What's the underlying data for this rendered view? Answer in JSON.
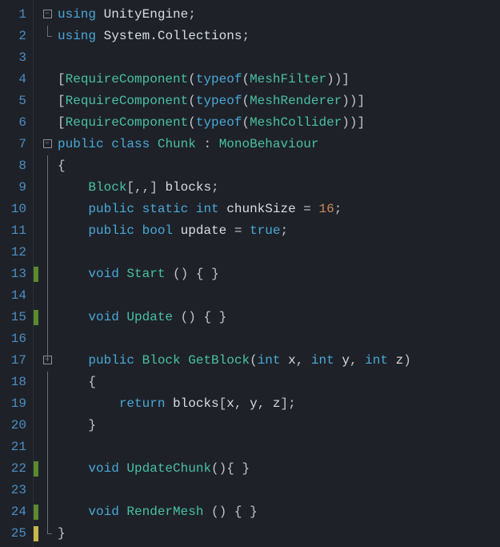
{
  "lines": [
    "1",
    "2",
    "3",
    "4",
    "5",
    "6",
    "7",
    "8",
    "9",
    "10",
    "11",
    "12",
    "13",
    "14",
    "15",
    "16",
    "17",
    "18",
    "19",
    "20",
    "21",
    "22",
    "23",
    "24",
    "25"
  ],
  "code": {
    "l1": {
      "using": "using",
      "ns": "UnityEngine",
      "semi": ";"
    },
    "l2": {
      "using": "using",
      "ns": "System.Collections",
      "semi": ";"
    },
    "l4": {
      "lb": "[",
      "attr": "RequireComponent",
      "lp": "(",
      "typeof": "typeof",
      "lp2": "(",
      "t": "MeshFilter",
      "rp2": ")",
      "rp": ")",
      "rb": "]"
    },
    "l5": {
      "lb": "[",
      "attr": "RequireComponent",
      "lp": "(",
      "typeof": "typeof",
      "lp2": "(",
      "t": "MeshRenderer",
      "rp2": ")",
      "rp": ")",
      "rb": "]"
    },
    "l6": {
      "lb": "[",
      "attr": "RequireComponent",
      "lp": "(",
      "typeof": "typeof",
      "lp2": "(",
      "t": "MeshCollider",
      "rp2": ")",
      "rp": ")",
      "rb": "]"
    },
    "l7": {
      "public": "public",
      "class": "class",
      "name": "Chunk",
      "colon": ":",
      "base": "MonoBehaviour"
    },
    "l8": {
      "brace": "{"
    },
    "l9": {
      "t": "Block",
      "arr": "[,,]",
      "name": "blocks",
      "semi": ";"
    },
    "l10": {
      "public": "public",
      "static": "static",
      "int": "int",
      "name": "chunkSize",
      "eq": "=",
      "val": "16",
      "semi": ";"
    },
    "l11": {
      "public": "public",
      "bool": "bool",
      "name": "update",
      "eq": "=",
      "val": "true",
      "semi": ";"
    },
    "l13": {
      "void": "void",
      "name": "Start",
      "parens": "()",
      "body": "{ }"
    },
    "l15": {
      "void": "void",
      "name": "Update",
      "parens": "()",
      "body": "{ }"
    },
    "l17": {
      "public": "public",
      "ret": "Block",
      "name": "GetBlock",
      "lp": "(",
      "int1": "int",
      "p1": "x",
      "c1": ",",
      "int2": "int",
      "p2": "y",
      "c2": ",",
      "int3": "int",
      "p3": "z",
      "rp": ")"
    },
    "l18": {
      "brace": "{"
    },
    "l19": {
      "return": "return",
      "expr1": "blocks",
      "lb": "[",
      "x": "x",
      "c1": ",",
      "y": "y",
      "c2": ",",
      "z": "z",
      "rb": "]",
      "semi": ";"
    },
    "l20": {
      "brace": "}"
    },
    "l22": {
      "void": "void",
      "name": "UpdateChunk",
      "parens": "()",
      "body": "{ }"
    },
    "l24": {
      "void": "void",
      "name": "RenderMesh",
      "parens": "()",
      "body": "{ }"
    },
    "l25": {
      "brace": "}"
    }
  },
  "chart_data": {
    "type": "table",
    "title": "C# source code (Chunk.cs)",
    "lines": [
      "using UnityEngine;",
      "using System.Collections;",
      "",
      "[RequireComponent(typeof(MeshFilter))]",
      "[RequireComponent(typeof(MeshRenderer))]",
      "[RequireComponent(typeof(MeshCollider))]",
      "public class Chunk : MonoBehaviour",
      "{",
      "    Block[,,] blocks;",
      "    public static int chunkSize = 16;",
      "    public bool update = true;",
      "",
      "    void Start () { }",
      "",
      "    void Update () { }",
      "",
      "    public Block GetBlock(int x, int y, int z)",
      "    {",
      "        return blocks[x, y, z];",
      "    }",
      "",
      "    void UpdateChunk(){ }",
      "",
      "    void RenderMesh () { }",
      "}"
    ]
  }
}
